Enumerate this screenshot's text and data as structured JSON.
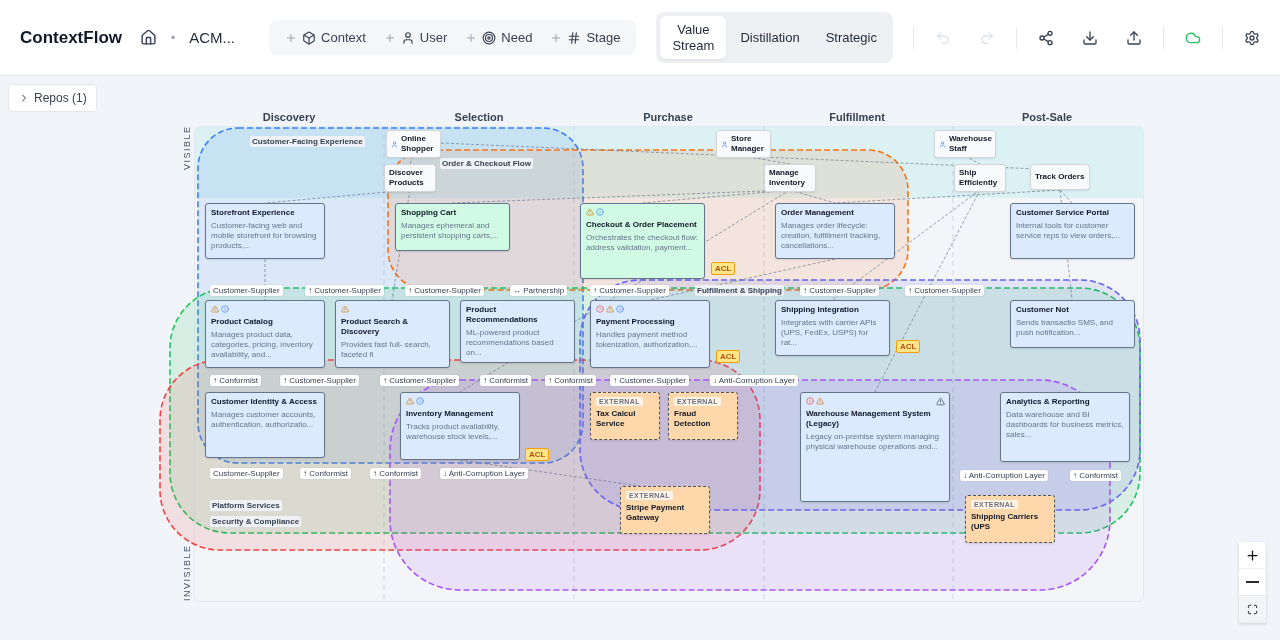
{
  "app": {
    "title": "ContextFlow",
    "separator": "•",
    "project": "ACM..."
  },
  "add_toolbar": [
    {
      "kind": "context",
      "label": "Context"
    },
    {
      "kind": "user",
      "label": "User"
    },
    {
      "kind": "need",
      "label": "Need"
    },
    {
      "kind": "stage",
      "label": "Stage"
    }
  ],
  "views": [
    {
      "label": "Value Stream",
      "selected": true
    },
    {
      "label": "Distillation",
      "selected": false
    },
    {
      "label": "Strategic",
      "selected": false
    }
  ],
  "actions": [
    {
      "kind": "undo",
      "disabled": true
    },
    {
      "kind": "redo",
      "disabled": true
    },
    {
      "kind": "share",
      "disabled": false
    },
    {
      "kind": "download",
      "disabled": false
    },
    {
      "kind": "upload",
      "disabled": false
    },
    {
      "kind": "cloud",
      "disabled": false,
      "color": "#22c55e"
    },
    {
      "kind": "settings",
      "disabled": false
    }
  ],
  "repos_button": "Repos (1)",
  "stages": [
    "Discovery",
    "Selection",
    "Purchase",
    "Fulfillment",
    "Post-Sale"
  ],
  "bands": {
    "visible": "VISIBLE",
    "invisible": "INVISIBLE"
  },
  "groups": [
    {
      "label": "Customer-Facing Experience",
      "color": "#3b82f6"
    },
    {
      "label": "Order & Checkout Flow",
      "color": "#f97316"
    },
    {
      "label": "Platform Services",
      "color": "#22c55e"
    },
    {
      "label": "Security & Compliance",
      "color": "#ef4444"
    },
    {
      "label": "Fulfillment & Shipping",
      "color": "#6366f1"
    },
    {
      "color": "#a855f7"
    }
  ],
  "users": [
    "Online Shopper",
    "Store Manager",
    "Warehouse Staff"
  ],
  "needs": [
    "Discover Products",
    "Manage Inventory",
    "Ship Efficiently",
    "Track Orders"
  ],
  "contexts": [
    {
      "kind": "internal",
      "title": "Storefront Experience",
      "description": "Customer-facing web and mobile storefront for browsing products,...",
      "color": "#dbeafe"
    },
    {
      "kind": "internal",
      "title": "Shopping Cart",
      "description": "Manages ephemeral and persistent shopping carts,...",
      "color": "#d1fae5"
    },
    {
      "kind": "internal",
      "title": "Checkout & Order Placement",
      "description": "Orchestrates the checkout flow: address validation, payment...",
      "color": "#d1fae5",
      "warning": true,
      "info": true,
      "badge": "ACL"
    },
    {
      "kind": "internal",
      "title": "Order Management",
      "description": "Manages order lifecycle: creation, fulfillment tracking, cancellations...",
      "color": "#dbeafe"
    },
    {
      "kind": "internal",
      "title": "Customer Service Portal",
      "description": "Internal tools for customer service reps to view orders,...",
      "color": "#dbeafe"
    },
    {
      "kind": "internal",
      "title": "Product Catalog",
      "description": "Manages product data, categories, pricing, inventory availability, and...",
      "color": "#dbeafe",
      "warning": true,
      "info": true
    },
    {
      "kind": "internal",
      "title": "Product Search & Discovery",
      "description": "Provides fast full- search, faceted fi",
      "color": "#dbeafe",
      "warning": true
    },
    {
      "kind": "internal",
      "title": "Product Recommendations",
      "description": "ML-powered product recommendations based on...",
      "color": "#dbeafe"
    },
    {
      "kind": "internal",
      "title": "Payment Processing",
      "description": "Handles payment method tokenization, authorization,...",
      "color": "#dbeafe",
      "warning": true,
      "info": true,
      "error": true,
      "badge": "ACL"
    },
    {
      "kind": "internal",
      "title": "Shipping Integration",
      "description": "Integrates with carrier APIs (UPS, FedEx, USPS) for rat...",
      "color": "#dbeafe",
      "badge": "ACL"
    },
    {
      "kind": "internal",
      "title": "Customer Not",
      "description": "Sends transactio SMS, and push notification...",
      "color": "#dbeafe"
    },
    {
      "kind": "internal",
      "title": "Customer Identity & Access",
      "description": "Manages customer accounts, authentication, authorizatio...",
      "color": "#dbeafe"
    },
    {
      "kind": "internal",
      "title": "Inventory Management",
      "description": "Tracks product availability, warehouse stock levels,...",
      "color": "#dbeafe",
      "warning": true,
      "info": true,
      "badge": "ACL"
    },
    {
      "kind": "external",
      "tag": "EXTERNAL",
      "title": "Tax Calcul Service",
      "color": "#fed7aa"
    },
    {
      "kind": "external",
      "tag": "EXTERNAL",
      "title": "Fraud Detection",
      "color": "#fed7aa"
    },
    {
      "kind": "internal",
      "title": "Warehouse Management System (Legacy)",
      "description": "Legacy on-premise system managing physical warehouse operations and...",
      "color": "#dbeafe",
      "warning": true,
      "error": true,
      "legacy": true
    },
    {
      "kind": "internal",
      "title": "Analytics & Reporting",
      "description": "Data warehouse and BI dashboards for business metrics, sales...",
      "color": "#dbeafe"
    },
    {
      "kind": "external",
      "tag": "EXTERNAL",
      "title": "Stripe Payment Gateway",
      "color": "#fed7aa"
    },
    {
      "kind": "external",
      "tag": "EXTERNAL",
      "title": "Shipping Carriers (UPS",
      "color": "#fed7aa"
    }
  ],
  "relationships": [
    "Customer-Supplier",
    "↑ Customer-Supplier",
    "↑ Customer-Supplier",
    "↔ Partnership",
    "↑ Customer-Supplier",
    "↑ Customer-Supplier",
    "↑ Customer-Supplier",
    "↑ Conformist",
    "↑ Customer-Supplier",
    "↑ Customer-Supplier",
    "↑ Conformist",
    "↑ Conformist",
    "↑ Customer-Supplier",
    "↓ Anti-Corruption Layer",
    "Customer-Supplier",
    "↑ Conformist",
    "↑ Conformist",
    "↓ Anti-Corruption Layer",
    "↓ Anti-Corruption Layer",
    "↑ Conformist"
  ],
  "zoom_controls": [
    {
      "kind": "zoom_in"
    },
    {
      "kind": "zoom_out"
    },
    {
      "kind": "fit"
    }
  ]
}
